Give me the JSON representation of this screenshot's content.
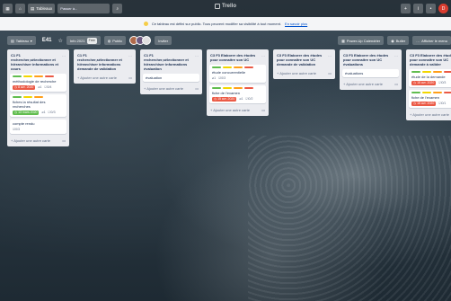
{
  "topbar": {
    "boards_label": "Tableaux",
    "search_placeholder": "Passer à...",
    "logo": "Trello",
    "right_plus": "+",
    "right_info": "i",
    "right_bell": "•",
    "avatar_initial": "D"
  },
  "notice": {
    "text": "Ce tableau est défini sur public. Tous peuvent modifier sa visibilité à tout moment.",
    "link": "En savoir plus"
  },
  "board": {
    "view_label": "Tableau",
    "title": "E41",
    "team": "Info 2021",
    "team_badge": "Free",
    "visibility": "Public",
    "invite": "Inviter",
    "powerup": "Power-Up Calendrier",
    "automation": "Butler",
    "menu": "Afficher le menu"
  },
  "colors": {
    "green": "#61bd4f",
    "yellow": "#f2d600",
    "orange": "#ff9f1a",
    "red": "#eb5a46",
    "purple": "#c377e0",
    "blue": "#0079bf",
    "due_red": "#eb5a46",
    "due_green": "#61bd4f"
  },
  "add_card_label": "Ajouter une autre carte",
  "lists": [
    {
      "title": "C1 F1 rechercher,sélectionner et hiérarchiser informations et cours",
      "cards": [
        {
          "title": "méthodologie de recherche",
          "labels": [
            "green",
            "yellow",
            "orange",
            "red"
          ],
          "due": "8 avr. 2020",
          "due_color": "red",
          "attach": "1",
          "check": "0/4"
        },
        {
          "title": "fiches la résultat des recherches",
          "labels": [
            "green",
            "yellow",
            "orange"
          ],
          "due": "13 mars 2020",
          "due_color": "green",
          "attach": "1",
          "check": "0/3"
        },
        {
          "title": "compte rendu",
          "labels": [],
          "due": "",
          "due_color": "",
          "attach": "",
          "check": "0/3"
        }
      ]
    },
    {
      "title": "C1 F1 rechercher,sélectionner et hiérarchiser informations demande de validation",
      "cards": []
    },
    {
      "title": "C1 F1 rechercher,sélectionner et hiérarchiser informations évaluation",
      "cards": [
        {
          "title": "évaluation",
          "labels": [],
          "due": "",
          "due_color": "",
          "attach": "",
          "check": ""
        }
      ]
    },
    {
      "title": "C3 F3 Elaborer des études pour connaitre son UC",
      "cards": [
        {
          "title": "étude concurrentielle",
          "labels": [
            "green",
            "yellow",
            "orange",
            "red"
          ],
          "due": "",
          "due_color": "",
          "attach": "1",
          "check": "0/3"
        },
        {
          "title": "fiche de l'examen",
          "labels": [
            "green",
            "yellow",
            "orange",
            "red"
          ],
          "due": "15 avr. 2020",
          "due_color": "red",
          "attach": "1",
          "check": "0/2"
        }
      ]
    },
    {
      "title": "C3 F3 Elaborer des études pour connaitre son UC demande de validation",
      "cards": []
    },
    {
      "title": "C3 F3 Elaborer des études pour connaitre son UC évaluations",
      "cards": [
        {
          "title": "évaluations",
          "labels": [],
          "due": "",
          "due_color": "",
          "attach": "",
          "check": ""
        }
      ]
    },
    {
      "title": "C3 F3 Elaborer des études pour connaitre son UC demande à valider",
      "cards": [
        {
          "title": "étude de la demande",
          "labels": [
            "green",
            "yellow",
            "orange",
            "red"
          ],
          "due": "15 avr. 2020",
          "due_color": "red",
          "attach": "",
          "check": "0/3"
        },
        {
          "title": "fiche de l'examen",
          "labels": [
            "green",
            "yellow",
            "orange",
            "red"
          ],
          "due": "15 avr. 2020",
          "due_color": "red",
          "attach": "",
          "check": "0/1"
        }
      ]
    }
  ]
}
